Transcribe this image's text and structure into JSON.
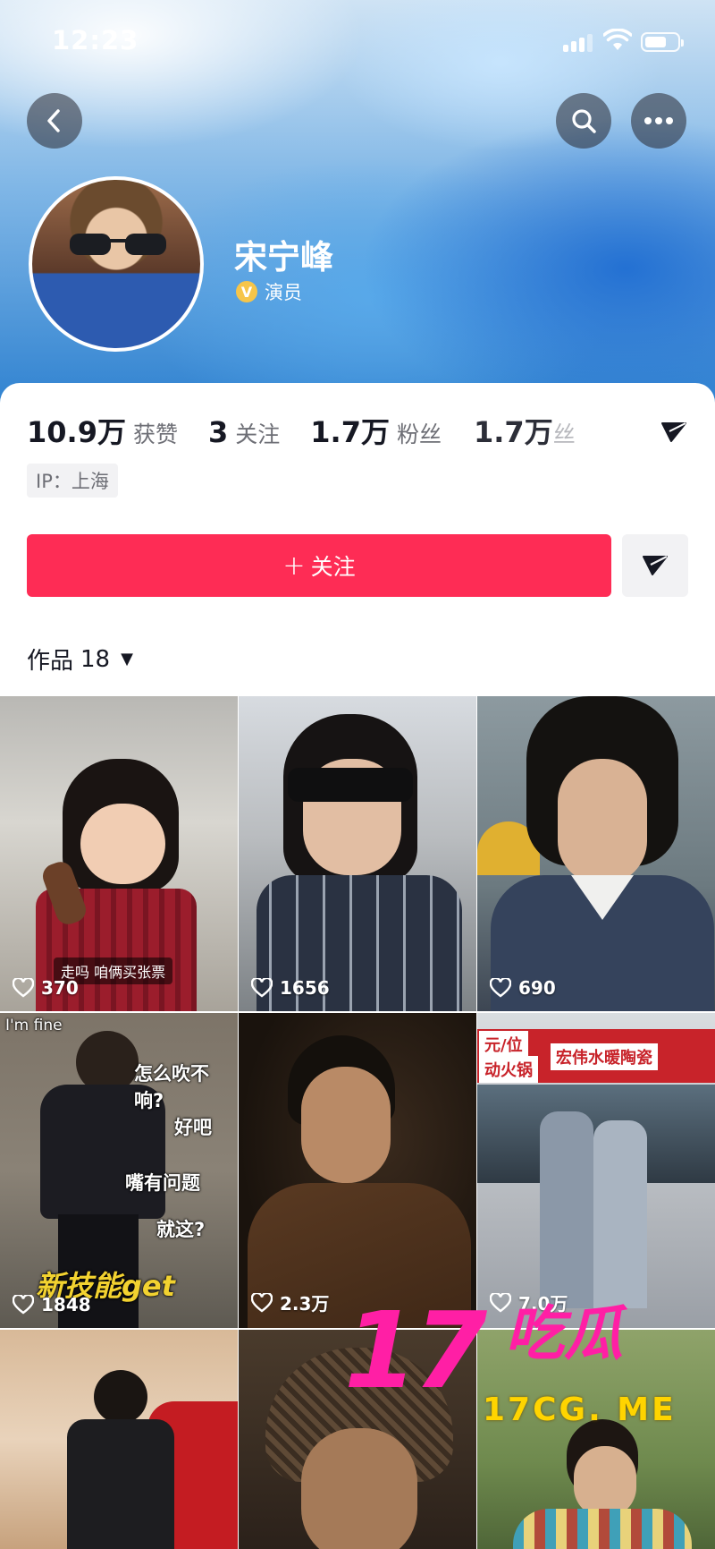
{
  "status_bar": {
    "time": "12:23",
    "battery_level": 0.7
  },
  "profile": {
    "name": "宋宁峰",
    "verified_label": "演员"
  },
  "stats": [
    {
      "value": "10.9万",
      "label": "获赞"
    },
    {
      "value": "3",
      "label": "关注"
    },
    {
      "value": "1.7万",
      "label": "粉丝"
    }
  ],
  "stat_ghost": {
    "value": "1.7万",
    "label": "丝"
  },
  "ip_label": "IP：上海",
  "actions": {
    "follow_plus": "+",
    "follow_label": "关注"
  },
  "works_tab": {
    "label": "作品",
    "count": "18"
  },
  "videos": [
    {
      "likes": "370",
      "caption": "走吗 咱俩买张票"
    },
    {
      "likes": "1656"
    },
    {
      "likes": "690"
    },
    {
      "likes": "1848",
      "overlay": [
        "I'm fine",
        "怎么吹不响?",
        "好吧",
        "嘴有问题",
        "就这?",
        "新技能get"
      ]
    },
    {
      "likes": "2.3万"
    },
    {
      "likes": "7.0万",
      "signs": [
        "元/位",
        "动火锅",
        "宏伟水暖陶瓷"
      ]
    },
    {
      "likes": ""
    },
    {
      "likes": ""
    },
    {
      "likes": ""
    }
  ],
  "watermark": {
    "number": "17",
    "brand": "吃瓜",
    "url": "17CG. ME"
  },
  "colors": {
    "accent": "#fe2c55",
    "verified": "#f6c54a",
    "watermark_pink": "#ff1fa5",
    "watermark_yellow": "#ffd400"
  },
  "icons": [
    "back-arrow-icon",
    "search-icon",
    "more-dots-icon",
    "share-arrow-icon",
    "heart-icon",
    "caret-down-icon",
    "verified-v-icon"
  ]
}
